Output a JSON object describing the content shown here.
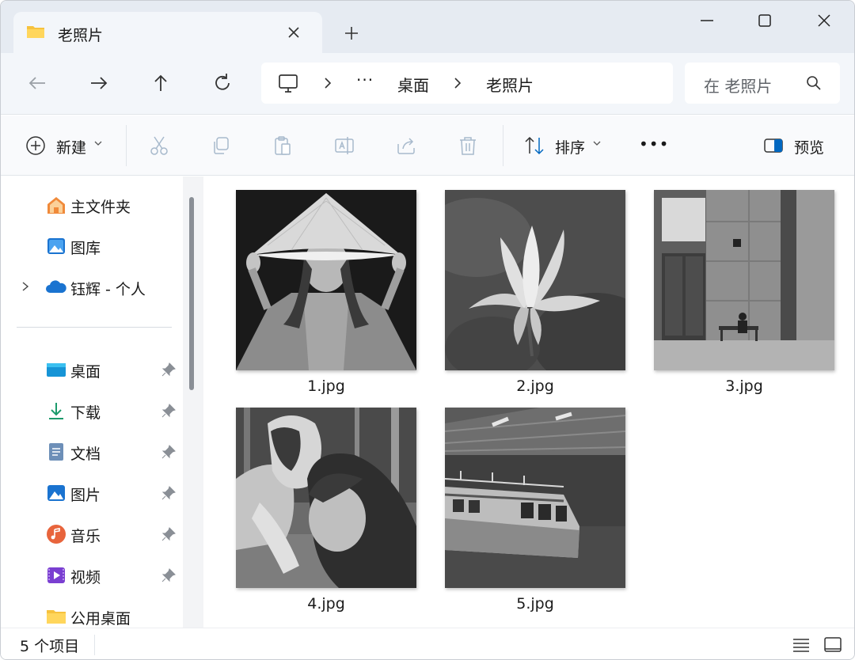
{
  "window": {
    "tab_title": "老照片",
    "controls": [
      "minimize",
      "maximize",
      "close"
    ]
  },
  "navigation": {
    "buttons": [
      "back",
      "forward",
      "up",
      "refresh"
    ],
    "breadcrumb": [
      "桌面",
      "老照片"
    ],
    "overflow": "···",
    "search_placeholder": "在 老照片"
  },
  "commandbar": {
    "new_label": "新建",
    "sort_label": "排序",
    "more_label": "•••",
    "preview_label": "预览"
  },
  "sidebar": {
    "items": [
      {
        "label": "主文件夹",
        "icon": "home-icon",
        "pinned": false
      },
      {
        "label": "图库",
        "icon": "gallery-icon",
        "pinned": false
      },
      {
        "label": "钰辉 - 个人",
        "icon": "onedrive-cloud-icon",
        "pinned": false
      },
      {
        "label": "桌面",
        "icon": "desktop-icon",
        "pinned": true
      },
      {
        "label": "下载",
        "icon": "download-icon",
        "pinned": true
      },
      {
        "label": "文档",
        "icon": "documents-icon",
        "pinned": true
      },
      {
        "label": "图片",
        "icon": "pictures-icon",
        "pinned": true
      },
      {
        "label": "音乐",
        "icon": "music-icon",
        "pinned": true
      },
      {
        "label": "视频",
        "icon": "videos-icon",
        "pinned": true
      },
      {
        "label": "公用桌面",
        "icon": "folder-icon",
        "pinned": false
      }
    ]
  },
  "files": [
    {
      "name": "1.jpg"
    },
    {
      "name": "2.jpg"
    },
    {
      "name": "3.jpg"
    },
    {
      "name": "4.jpg"
    },
    {
      "name": "5.jpg"
    }
  ],
  "status": {
    "item_count": "5 个项目"
  },
  "colors": {
    "accent": "#0067c0",
    "titlebar": "#e6ebf2",
    "folder_yellow": "#f6c23e"
  }
}
